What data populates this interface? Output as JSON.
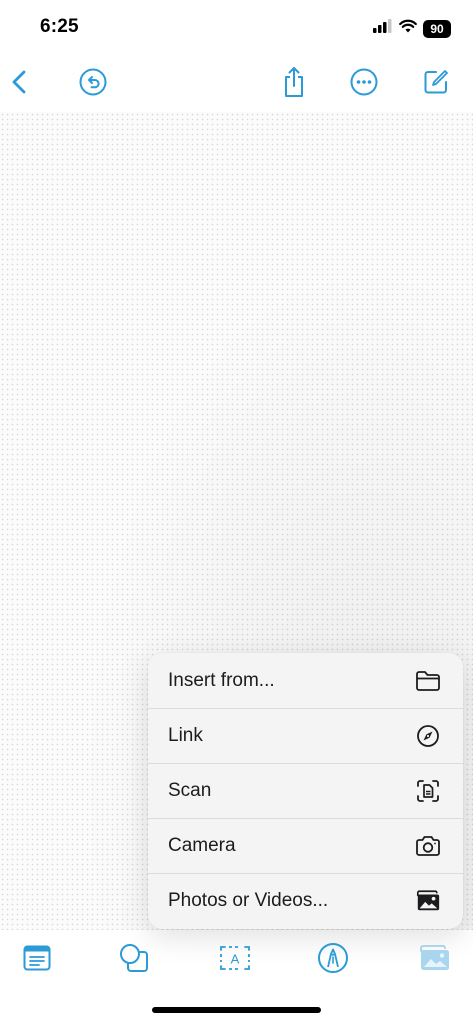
{
  "status_bar": {
    "time": "6:25",
    "battery": "90",
    "icons": [
      "cellular-signal-icon",
      "wifi-icon",
      "battery-icon"
    ]
  },
  "top_nav": {
    "icons": [
      "chevron-left-icon",
      "undo-icon",
      "share-icon",
      "more-icon",
      "compose-icon"
    ]
  },
  "menu": {
    "items": [
      {
        "label": "Insert from...",
        "icon": "folder-icon"
      },
      {
        "label": "Link",
        "icon": "compass-icon"
      },
      {
        "label": "Scan",
        "icon": "scan-document-icon"
      },
      {
        "label": "Camera",
        "icon": "camera-icon"
      },
      {
        "label": "Photos or Videos...",
        "icon": "photos-icon"
      }
    ]
  },
  "bottom_toolbar": {
    "icons": [
      "sticky-note-icon",
      "shapes-icon",
      "text-box-icon",
      "pen-icon",
      "media-icon"
    ]
  },
  "colors": {
    "accent": "#2a9bd6",
    "accent_faded": "#a9d6ee",
    "menu_background": "#f4f4f4",
    "canvas_dots": "#d9d9d9"
  }
}
